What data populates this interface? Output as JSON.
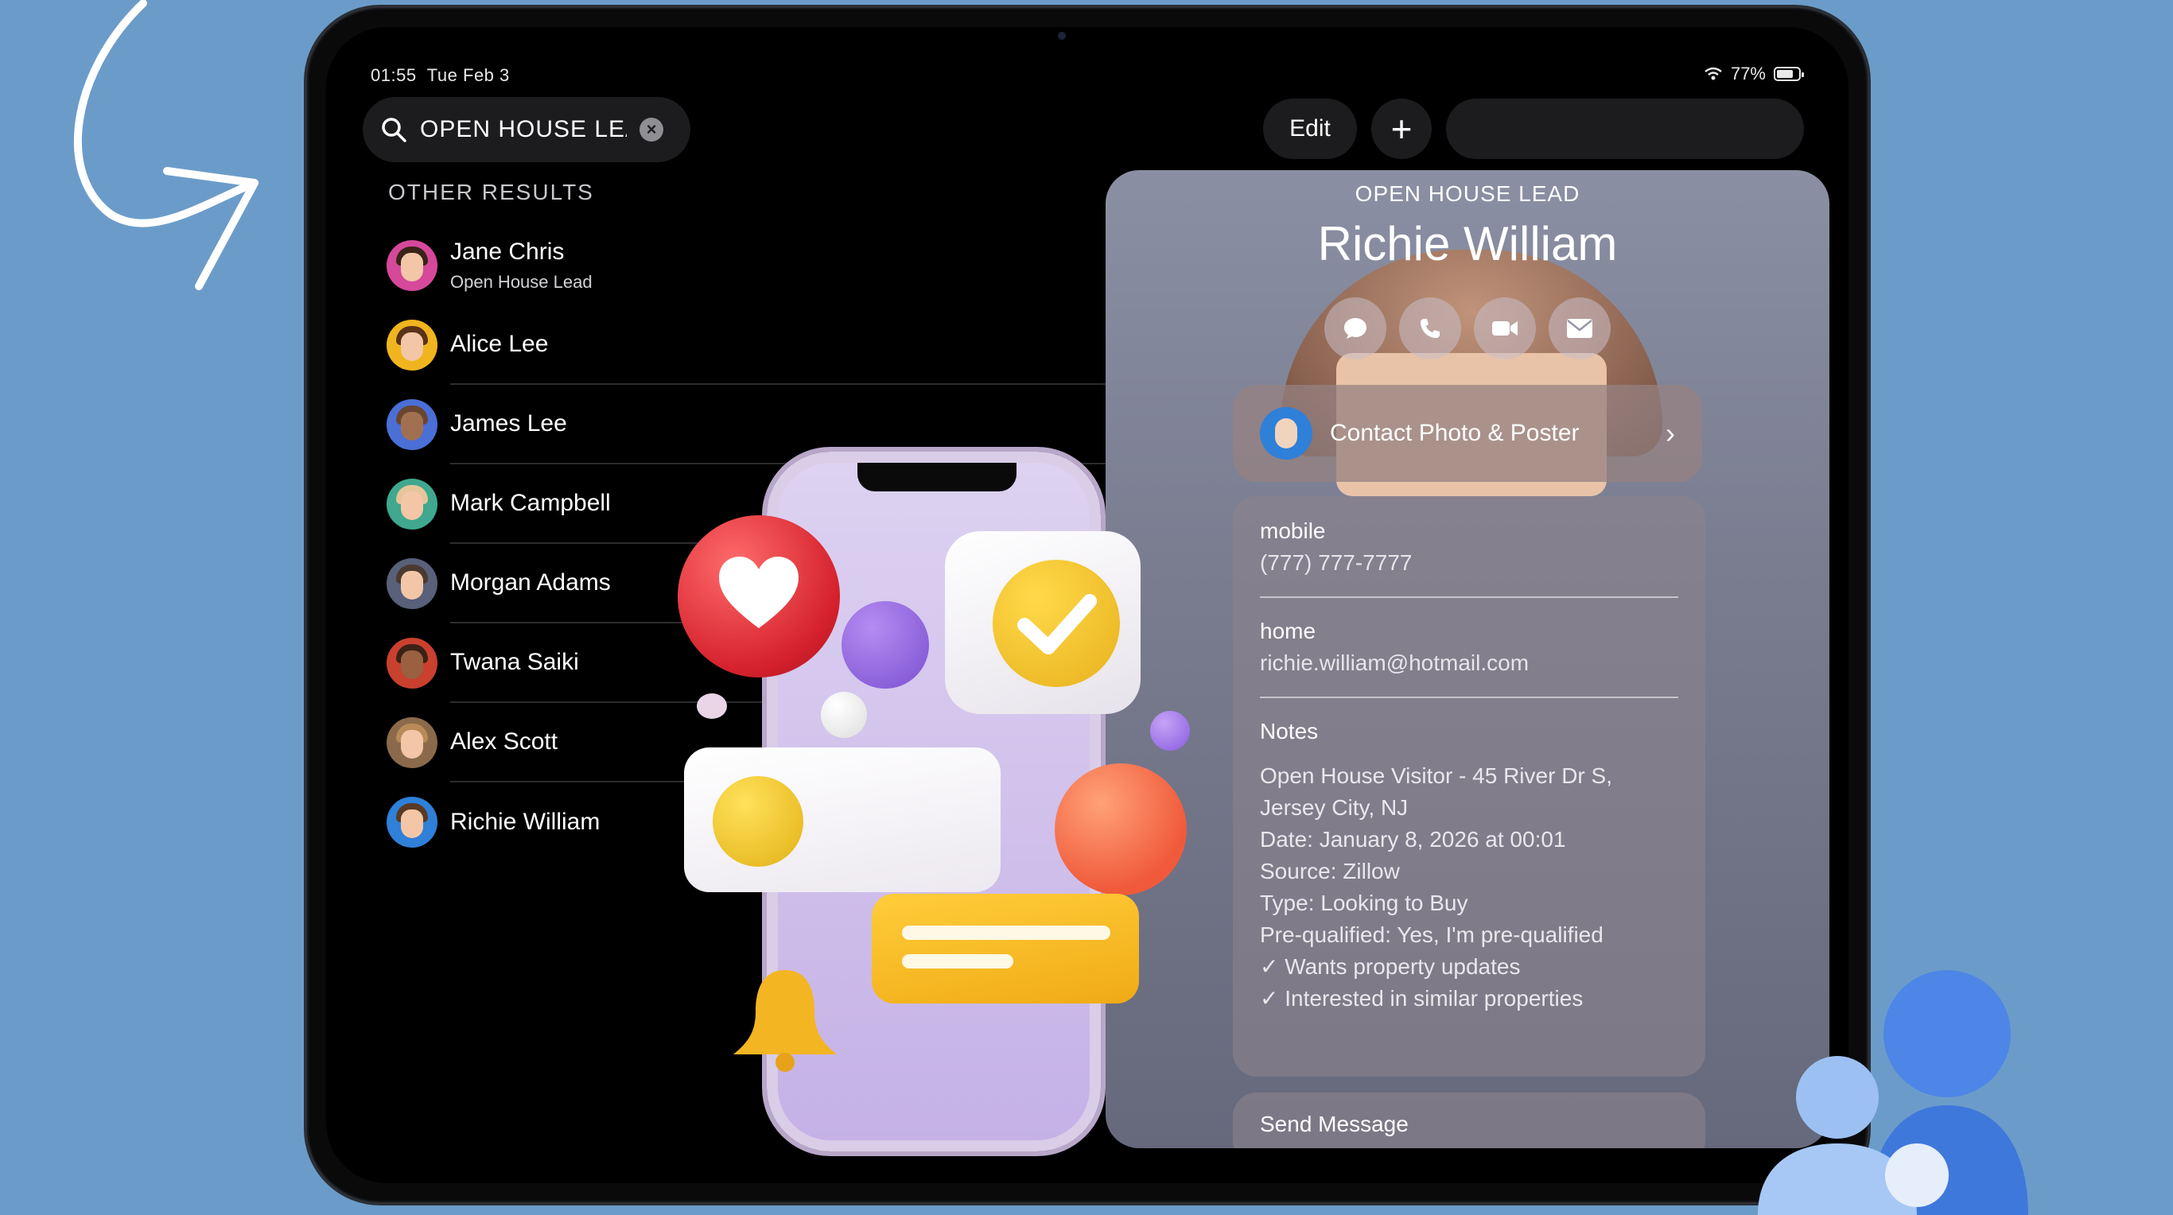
{
  "status": {
    "time": "01:55",
    "date": "Tue Feb 3",
    "battery": "77%"
  },
  "search": {
    "value": "OPEN HOUSE LEAI",
    "placeholder": "Search"
  },
  "section_label": "OTHER RESULTS",
  "contacts": [
    {
      "name": "Jane Chris",
      "subtitle": "Open House Lead",
      "avatar_color": "#d6489a",
      "hair_color": "#3a2318"
    },
    {
      "name": "Alice Lee",
      "subtitle": "",
      "avatar_color": "#f0b51e",
      "hair_color": "#5a3318"
    },
    {
      "name": "James Lee",
      "subtitle": "",
      "avatar_color": "#4a6fd6",
      "hair_color": "#6a4530"
    },
    {
      "name": "Mark Campbell",
      "subtitle": "",
      "avatar_color": "#3fa88e",
      "hair_color": "#e6c59a"
    },
    {
      "name": "Morgan Adams",
      "subtitle": "",
      "avatar_color": "#58607a",
      "hair_color": "#4a3a30"
    },
    {
      "name": "Twana Saiki",
      "subtitle": "",
      "avatar_color": "#c9402e",
      "hair_color": "#3b2216"
    },
    {
      "name": "Alex Scott",
      "subtitle": "",
      "avatar_color": "#8a6a4a",
      "hair_color": "#b88a58"
    },
    {
      "name": "Richie William",
      "subtitle": "",
      "avatar_color": "#2f80d9",
      "hair_color": "#5a3a25"
    }
  ],
  "toolbar": {
    "edit_label": "Edit",
    "add_label": "+"
  },
  "contact_card": {
    "header": "OPEN HOUSE LEAD",
    "name": "Richie William",
    "actions": [
      "message-icon",
      "phone-icon",
      "video-icon",
      "mail-icon"
    ],
    "poster_label": "Contact Photo & Poster",
    "mobile_label": "mobile",
    "mobile_value": "(777) 777-7777",
    "home_label": "home",
    "home_value": "richie.william@hotmail.com",
    "notes_label": "Notes",
    "notes": [
      "Open House Visitor - 45 River Dr S,",
      "Jersey City, NJ",
      "Date: January 8, 2026 at 00:01",
      "Source: Zillow",
      "Type: Looking to Buy",
      "Pre-qualified: Yes, I'm pre-qualified",
      "✓ Wants property updates",
      "✓ Interested in similar properties"
    ],
    "send_message": "Send Message"
  },
  "colors": {
    "background": "#6b9cc9",
    "device": "#0a0a0b",
    "card": "#7a7d90"
  }
}
